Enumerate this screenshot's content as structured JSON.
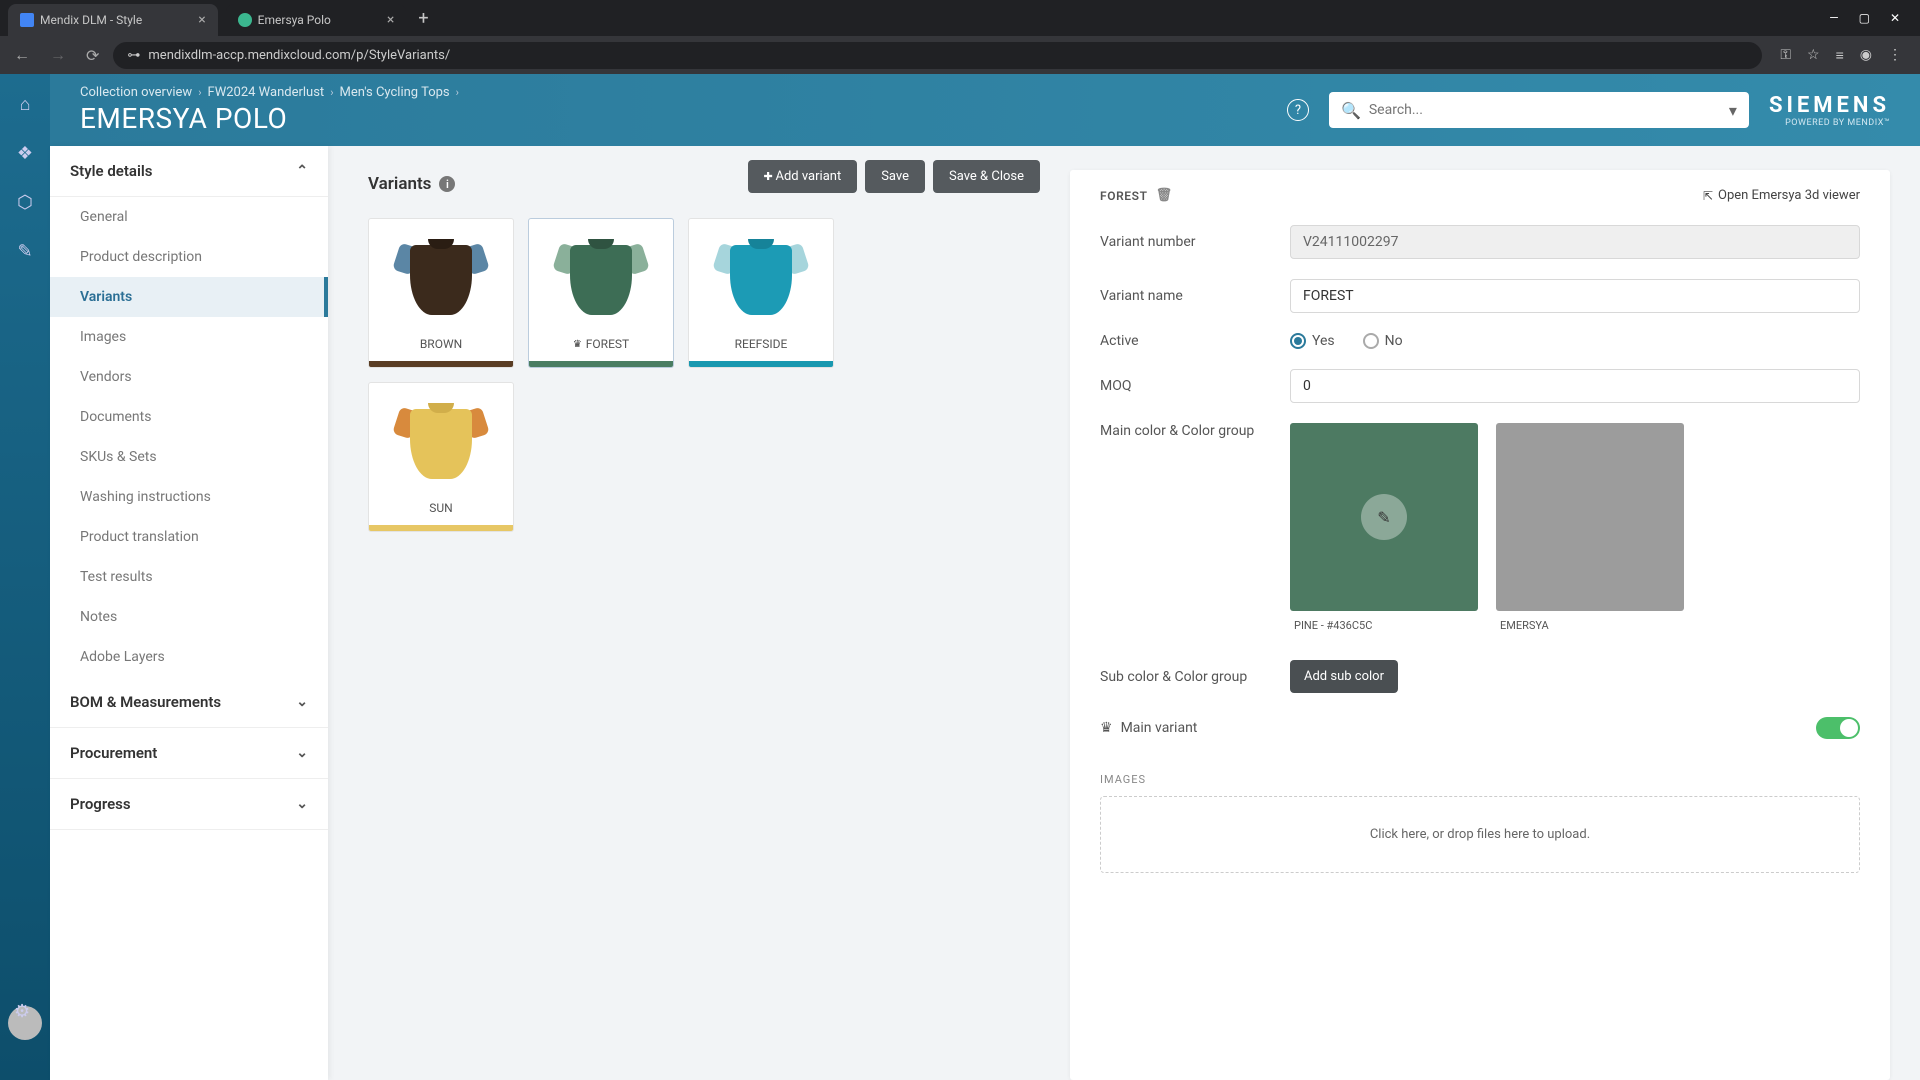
{
  "browser": {
    "tabs": [
      {
        "title": "Mendix DLM - Style",
        "active": true
      },
      {
        "title": "Emersya Polo",
        "active": false
      }
    ],
    "url": "mendixdlm-accp.mendixcloud.com/p/StyleVariants/"
  },
  "header": {
    "breadcrumbs": [
      "Collection overview",
      "FW2024 Wanderlust",
      "Men's Cycling Tops"
    ],
    "title": "EMERSYA POLO",
    "search_placeholder": "Search...",
    "brand": "SIEMENS",
    "brand_sub": "POWERED BY MENDIX™"
  },
  "sidebar": {
    "sections": {
      "style_details": {
        "label": "Style details",
        "expanded": true,
        "items": [
          "General",
          "Product description",
          "Variants",
          "Images",
          "Vendors",
          "Documents",
          "SKUs & Sets",
          "Washing instructions",
          "Product translation",
          "Test results",
          "Notes",
          "Adobe Layers"
        ],
        "active_index": 2
      },
      "bom": {
        "label": "BOM & Measurements",
        "expanded": false
      },
      "procurement": {
        "label": "Procurement",
        "expanded": false
      },
      "progress": {
        "label": "Progress",
        "expanded": false
      }
    }
  },
  "toolbar": {
    "add_variant": "Add variant",
    "save": "Save",
    "save_close": "Save & Close"
  },
  "variants": {
    "title": "Variants",
    "cards": [
      {
        "name": "BROWN",
        "body": "#3b2a1c",
        "sleeve": "#5b86a5",
        "collar": "#2a1d13",
        "bar": "#5a3d24",
        "main": false
      },
      {
        "name": "FOREST",
        "body": "#3d6d55",
        "sleeve": "#8ab09a",
        "collar": "#2f5341",
        "bar": "#4a7d62",
        "main": true
      },
      {
        "name": "REEFSIDE",
        "body": "#1c9bb5",
        "sleeve": "#a6d5dc",
        "collar": "#168399",
        "bar": "#1998b0",
        "main": false
      },
      {
        "name": "SUN",
        "body": "#e5c35a",
        "sleeve": "#d88a3d",
        "collar": "#d1ae4a",
        "bar": "#e7c765",
        "main": false
      }
    ],
    "selected_index": 1
  },
  "detail": {
    "name": "FOREST",
    "open_3d": "Open Emersya 3d viewer",
    "fields": {
      "variant_number_label": "Variant number",
      "variant_number": "V24111002297",
      "variant_name_label": "Variant name",
      "variant_name": "FOREST",
      "active_label": "Active",
      "active_yes": "Yes",
      "active_no": "No",
      "active_value": true,
      "moq_label": "MOQ",
      "moq": "0",
      "main_color_label": "Main color & Color group",
      "main_color": {
        "hex": "#4d7a62",
        "label": "PINE - #436C5C"
      },
      "color_group": {
        "hex": "#9c9c9c",
        "label": "EMERSYA"
      },
      "sub_color_label": "Sub color & Color group",
      "add_sub_color": "Add sub color",
      "main_variant_label": "Main variant",
      "main_variant": true,
      "images_label": "IMAGES",
      "dropzone": "Click here, or drop files here to upload."
    }
  }
}
